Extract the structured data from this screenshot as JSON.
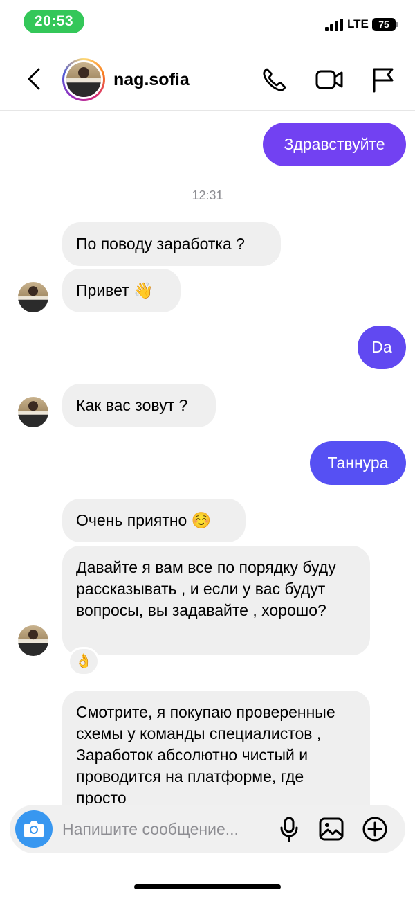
{
  "status_bar": {
    "time": "20:53",
    "network": "LTE",
    "battery": "75"
  },
  "header": {
    "username": "nag.sofia_"
  },
  "chat": {
    "outgoing_1": "Здравствуйте",
    "timestamp": "12:31",
    "incoming_1": "По поводу заработка ?",
    "incoming_2": "Привет 👋",
    "outgoing_2": "Da",
    "incoming_3": "Как вас зовут ?",
    "outgoing_3": "Таннура",
    "incoming_4": "Очень приятно ☺️",
    "incoming_5": "Давайте я вам все по порядку буду рассказывать , и если у вас будут вопросы, вы задавайте , хорошо?",
    "reaction": "👌",
    "incoming_6": "Смотрите, я покупаю проверенные схемы у команды специалистов  , Заработок абсолютно чистый и проводится на платформе, где просто"
  },
  "composer": {
    "placeholder": "Напишите сообщение..."
  },
  "colors": {
    "outgoing_bubble": "#6a4df5",
    "incoming_bubble": "#efefef",
    "status_pill": "#34c759",
    "camera_button": "#3897f0"
  }
}
